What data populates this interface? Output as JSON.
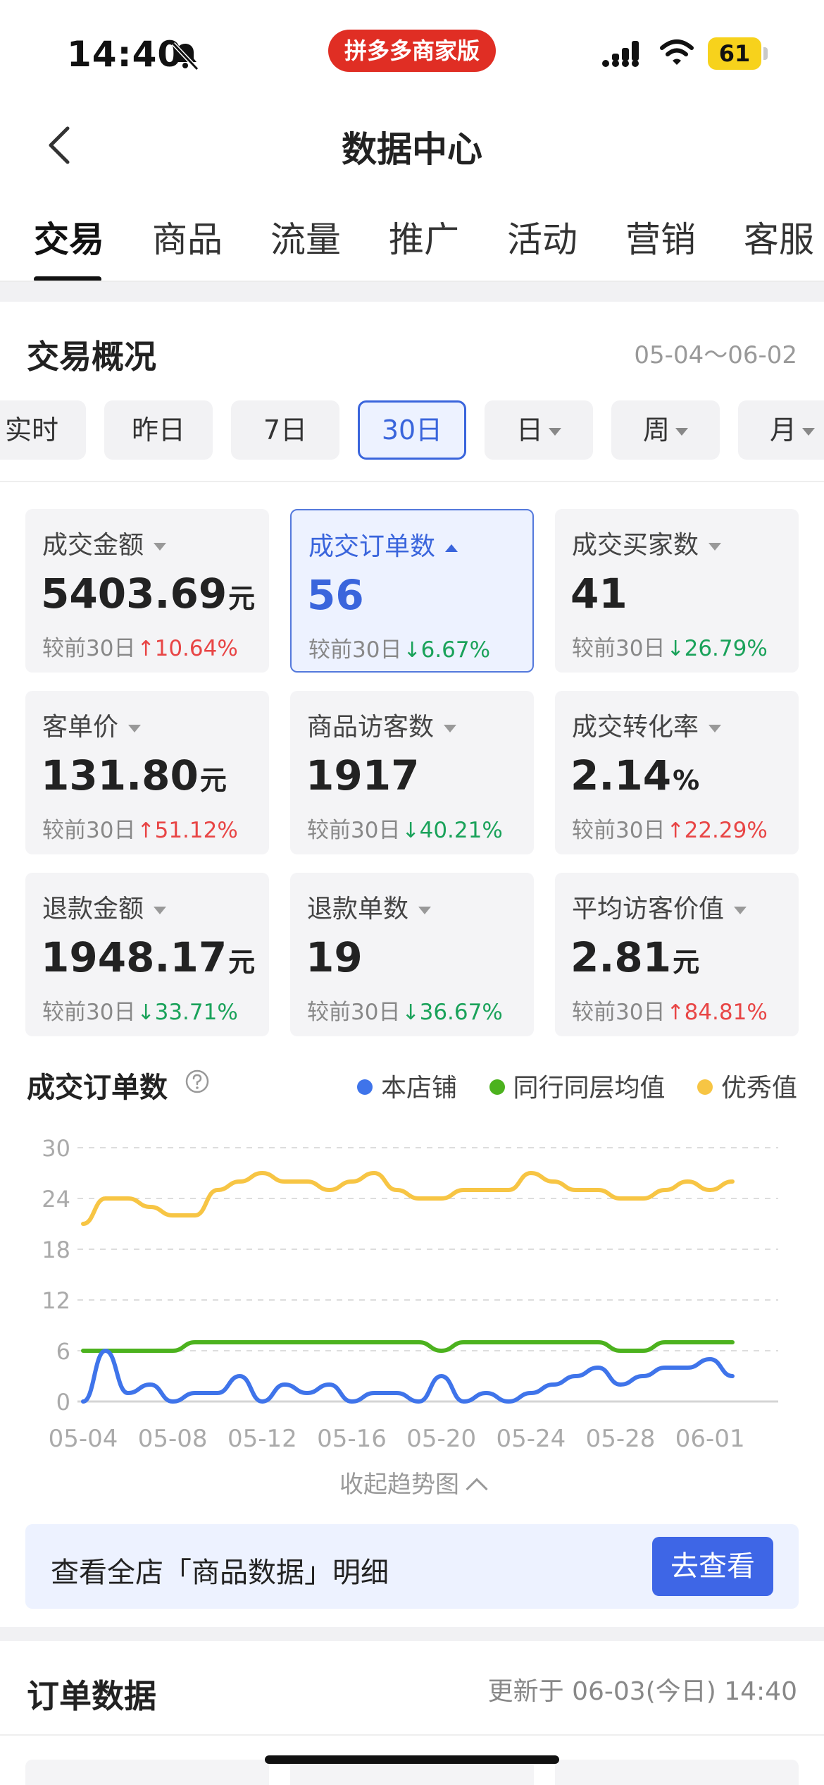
{
  "status_bar": {
    "time": "14:40",
    "app_pill": "拼多多商家版",
    "battery": "61",
    "icons": [
      "bell-slash-icon",
      "signal-icon",
      "wifi-icon",
      "battery-icon"
    ]
  },
  "nav": {
    "title": "数据中心",
    "back_icon": "chevron-left-icon"
  },
  "tabs": [
    {
      "label": "交易",
      "active": true
    },
    {
      "label": "商品"
    },
    {
      "label": "流量"
    },
    {
      "label": "推广"
    },
    {
      "label": "活动"
    },
    {
      "label": "营销"
    },
    {
      "label": "客服"
    }
  ],
  "overview": {
    "title": "交易概况",
    "date_range": "05-04～06-02",
    "periods": [
      {
        "label": "实时"
      },
      {
        "label": "昨日"
      },
      {
        "label": "7日"
      },
      {
        "label": "30日",
        "active": true
      },
      {
        "label": "日",
        "dropdown": true
      },
      {
        "label": "周",
        "dropdown": true
      },
      {
        "label": "月",
        "dropdown": true
      }
    ],
    "compare_prefix": "较前30日",
    "metrics": [
      {
        "label": "成交金额",
        "value": "5403.69",
        "unit": "元",
        "delta": "10.64%",
        "dir": "up"
      },
      {
        "label": "成交订单数",
        "value": "56",
        "unit": "",
        "delta": "6.67%",
        "dir": "down",
        "active": true
      },
      {
        "label": "成交买家数",
        "value": "41",
        "unit": "",
        "delta": "26.79%",
        "dir": "down"
      },
      {
        "label": "客单价",
        "value": "131.80",
        "unit": "元",
        "delta": "51.12%",
        "dir": "up"
      },
      {
        "label": "商品访客数",
        "value": "1917",
        "unit": "",
        "delta": "40.21%",
        "dir": "down"
      },
      {
        "label": "成交转化率",
        "value": "2.14",
        "unit": "%",
        "delta": "22.29%",
        "dir": "up"
      },
      {
        "label": "退款金额",
        "value": "1948.17",
        "unit": "元",
        "delta": "33.71%",
        "dir": "down"
      },
      {
        "label": "退款单数",
        "value": "19",
        "unit": "",
        "delta": "36.67%",
        "dir": "down"
      },
      {
        "label": "平均访客价值",
        "value": "2.81",
        "unit": "元",
        "delta": "84.81%",
        "dir": "up"
      }
    ]
  },
  "chart": {
    "title": "成交订单数",
    "collapse_label": "收起趋势图"
  },
  "chart_data": {
    "type": "line",
    "x": [
      "05-04",
      "05-05",
      "05-06",
      "05-07",
      "05-08",
      "05-09",
      "05-10",
      "05-11",
      "05-12",
      "05-13",
      "05-14",
      "05-15",
      "05-16",
      "05-17",
      "05-18",
      "05-19",
      "05-20",
      "05-21",
      "05-22",
      "05-23",
      "05-24",
      "05-25",
      "05-26",
      "05-27",
      "05-28",
      "05-29",
      "05-30",
      "05-31",
      "06-01",
      "06-02"
    ],
    "x_ticks": [
      "05-04",
      "05-08",
      "05-12",
      "05-16",
      "05-20",
      "05-24",
      "05-28",
      "06-01"
    ],
    "y_ticks": [
      0,
      6,
      12,
      18,
      24,
      30
    ],
    "ylim": [
      0,
      30
    ],
    "grid": true,
    "legend": "top-right",
    "series": [
      {
        "name": "本店铺",
        "color": "#3f74ea",
        "values": [
          0,
          6,
          1,
          2,
          0,
          1,
          1,
          3,
          0,
          2,
          1,
          2,
          0,
          1,
          1,
          0,
          3,
          0,
          1,
          0,
          1,
          2,
          3,
          4,
          2,
          3,
          4,
          4,
          5,
          3
        ]
      },
      {
        "name": "同行同层均值",
        "color": "#4cb21e",
        "values": [
          6,
          6,
          6,
          6,
          6,
          7,
          7,
          7,
          7,
          7,
          7,
          7,
          7,
          7,
          7,
          7,
          6,
          7,
          7,
          7,
          7,
          7,
          7,
          7,
          6,
          6,
          7,
          7,
          7,
          7
        ]
      },
      {
        "name": "优秀值",
        "color": "#f7c544",
        "values": [
          21,
          24,
          24,
          23,
          22,
          22,
          25,
          26,
          27,
          26,
          26,
          25,
          26,
          27,
          25,
          24,
          24,
          25,
          25,
          25,
          27,
          26,
          25,
          25,
          24,
          24,
          25,
          26,
          25,
          26
        ]
      }
    ]
  },
  "banner": {
    "text": "查看全店「商品数据」明细",
    "button": "去查看"
  },
  "orders": {
    "title": "订单数据",
    "updated": "更新于 06-03(今日) 14:40"
  }
}
